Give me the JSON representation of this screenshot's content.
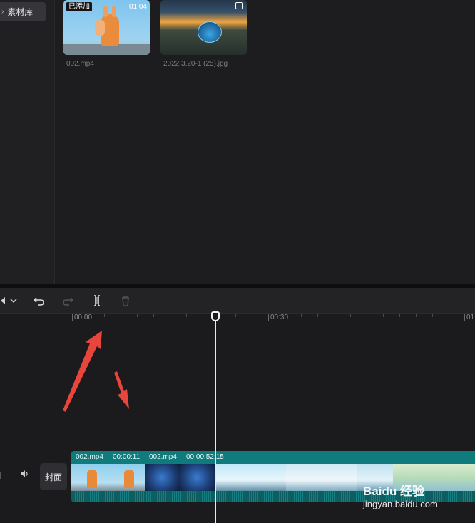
{
  "sidebar": {
    "library_tab_label": "素材库",
    "library_tab_chevron": "chevron-right-icon"
  },
  "media": {
    "items": [
      {
        "filename": "002.mp4",
        "badge": "已添加",
        "duration": "01:04",
        "type": "video"
      },
      {
        "filename": "2022.3.20-1 (25).jpg",
        "type": "image",
        "icon": "image-icon"
      }
    ]
  },
  "toolbar": {
    "select_icon": "pointer-select-icon",
    "dropdown_icon": "chevron-down-icon",
    "undo_icon": "undo-icon",
    "redo_icon": "redo-icon",
    "split_icon": "split-icon",
    "delete_icon": "trash-icon"
  },
  "ruler": {
    "labels": [
      "00:00",
      "00:30",
      "01"
    ]
  },
  "track": {
    "cover_label": "封面",
    "volume_icon": "speaker-icon",
    "clips": [
      {
        "name": "002.mp4",
        "time": "00:00:11."
      },
      {
        "name": "002.mp4",
        "time": "00:00:52:15"
      }
    ]
  },
  "watermark": {
    "brand": "Baidu 经验",
    "url": "jingyan.baidu.com"
  },
  "colors": {
    "clip_teal": "#0d6e70",
    "arrow_red": "#e8453c",
    "background": "#1b1b1d"
  }
}
